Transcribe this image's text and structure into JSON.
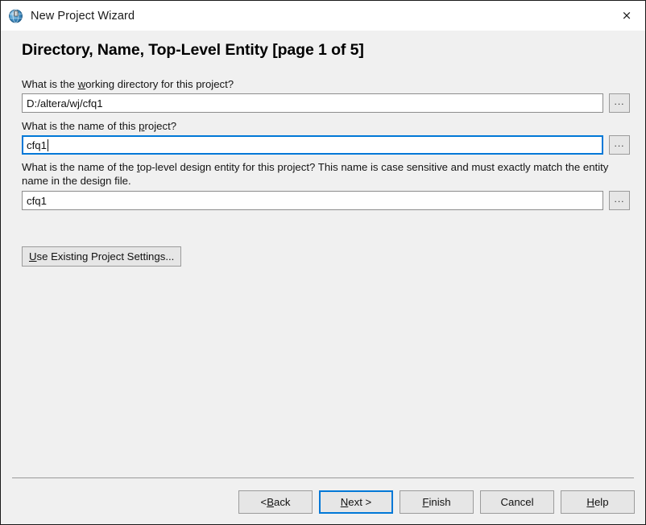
{
  "window": {
    "title": "New Project Wizard",
    "icon": "globe-icon",
    "close_label": "×",
    "accent_color": "#0078d7",
    "background_color": "#f0f0f0",
    "titlebar_color": "#ffffff"
  },
  "page": {
    "title": "Directory, Name, Top-Level Entity [page 1 of 5]"
  },
  "fields": [
    {
      "name": "working-directory",
      "label_before": "What is the ",
      "label_key": "w",
      "label_after": "orking directory for this project?",
      "value": "D:/altera/wj/cfq1",
      "placeholder": "",
      "focused": false,
      "browse_label": "..."
    },
    {
      "name": "project-name",
      "label_before": "What is the name of this ",
      "label_key": "p",
      "label_after": "roject?",
      "value": "cfq1",
      "placeholder": "",
      "focused": true,
      "browse_label": "..."
    },
    {
      "name": "top-level-entity",
      "label_before": "What is the name of the ",
      "label_key": "t",
      "label_after": "op-level design entity for this project? This name is case sensitive and must exactly match the entity name in the design file.",
      "value": "cfq1",
      "placeholder": "",
      "focused": false,
      "browse_label": "..."
    }
  ],
  "use_existing": {
    "key": "U",
    "rest": "se Existing Project Settings..."
  },
  "footer": {
    "buttons": [
      {
        "name": "back-button",
        "before": "< ",
        "key": "B",
        "after": "ack",
        "focused": false
      },
      {
        "name": "next-button",
        "before": "",
        "key": "N",
        "after": "ext >",
        "focused": true
      },
      {
        "name": "finish-button",
        "before": "",
        "key": "F",
        "after": "inish",
        "focused": false
      },
      {
        "name": "cancel-button",
        "before": "Cancel",
        "key": "",
        "after": "",
        "focused": false
      },
      {
        "name": "help-button",
        "before": "",
        "key": "H",
        "after": "elp",
        "focused": false
      }
    ]
  }
}
